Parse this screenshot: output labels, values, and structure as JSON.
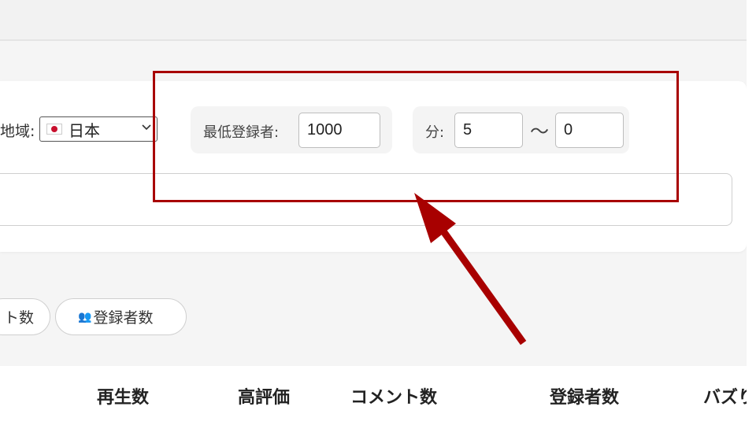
{
  "filters": {
    "region": {
      "label": "地域:",
      "value": "日本",
      "flag": "jp-flag"
    },
    "min_subscribers": {
      "label": "最低登録者:",
      "value": "1000"
    },
    "duration": {
      "label": "分:",
      "min": "5",
      "separator": "〜",
      "max": "0"
    }
  },
  "sort_pills": [
    {
      "label": "ト数"
    },
    {
      "label": "登録者数",
      "icon": "people-icon"
    }
  ],
  "table": {
    "headers": [
      "再生数",
      "高評価",
      "コメント数",
      "登録者数",
      "バズり"
    ]
  },
  "annotation": {
    "color": "#a80000"
  }
}
